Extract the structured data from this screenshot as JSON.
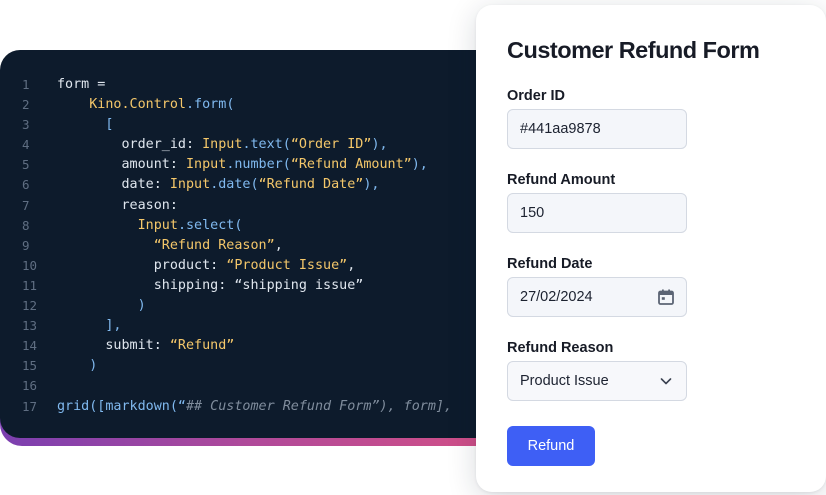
{
  "editor": {
    "lines": [
      {
        "n": "1",
        "tokens": [
          {
            "t": "form =",
            "c": "k-def"
          }
        ]
      },
      {
        "n": "2",
        "tokens": [
          {
            "t": "    ",
            "c": "k-def"
          },
          {
            "t": "Kino.Control",
            "c": "k-mod"
          },
          {
            "t": ".form",
            "c": "k-fn"
          },
          {
            "t": "(",
            "c": "k-pun"
          }
        ]
      },
      {
        "n": "3",
        "tokens": [
          {
            "t": "      [",
            "c": "k-pun"
          }
        ]
      },
      {
        "n": "4",
        "tokens": [
          {
            "t": "        order_id: ",
            "c": "k-def"
          },
          {
            "t": "Input",
            "c": "k-mod"
          },
          {
            "t": ".text",
            "c": "k-fn"
          },
          {
            "t": "(",
            "c": "k-pun"
          },
          {
            "t": "“Order ID”",
            "c": "k-str"
          },
          {
            "t": "),",
            "c": "k-pun"
          }
        ]
      },
      {
        "n": "5",
        "tokens": [
          {
            "t": "        amount: ",
            "c": "k-def"
          },
          {
            "t": "Input",
            "c": "k-mod"
          },
          {
            "t": ".number",
            "c": "k-fn"
          },
          {
            "t": "(",
            "c": "k-pun"
          },
          {
            "t": "“Refund Amount”",
            "c": "k-str"
          },
          {
            "t": "),",
            "c": "k-pun"
          }
        ]
      },
      {
        "n": "6",
        "tokens": [
          {
            "t": "        date: ",
            "c": "k-def"
          },
          {
            "t": "Input",
            "c": "k-mod"
          },
          {
            "t": ".date",
            "c": "k-fn"
          },
          {
            "t": "(",
            "c": "k-pun"
          },
          {
            "t": "“Refund Date”",
            "c": "k-str"
          },
          {
            "t": "),",
            "c": "k-pun"
          }
        ]
      },
      {
        "n": "7",
        "tokens": [
          {
            "t": "        reason:",
            "c": "k-def"
          }
        ]
      },
      {
        "n": "8",
        "tokens": [
          {
            "t": "          ",
            "c": "k-def"
          },
          {
            "t": "Input",
            "c": "k-mod"
          },
          {
            "t": ".select",
            "c": "k-fn"
          },
          {
            "t": "(",
            "c": "k-pun"
          }
        ]
      },
      {
        "n": "9",
        "tokens": [
          {
            "t": "            ",
            "c": "k-def"
          },
          {
            "t": "“Refund Reason”",
            "c": "k-str"
          },
          {
            "t": ",",
            "c": "k-def"
          }
        ]
      },
      {
        "n": "10",
        "tokens": [
          {
            "t": "            product: ",
            "c": "k-def"
          },
          {
            "t": "“Product Issue”",
            "c": "k-str"
          },
          {
            "t": ",",
            "c": "k-def"
          }
        ]
      },
      {
        "n": "11",
        "tokens": [
          {
            "t": "            shipping: “shipping issue”",
            "c": "k-def"
          }
        ]
      },
      {
        "n": "12",
        "tokens": [
          {
            "t": "          )",
            "c": "k-pun"
          }
        ]
      },
      {
        "n": "13",
        "tokens": [
          {
            "t": "      ],",
            "c": "k-pun"
          }
        ]
      },
      {
        "n": "14",
        "tokens": [
          {
            "t": "      submit: ",
            "c": "k-def"
          },
          {
            "t": "“Refund”",
            "c": "k-str"
          }
        ]
      },
      {
        "n": "15",
        "tokens": [
          {
            "t": "    )",
            "c": "k-pun"
          }
        ]
      },
      {
        "n": "16",
        "tokens": []
      },
      {
        "n": "17",
        "tokens": [
          {
            "t": "grid",
            "c": "k-fn"
          },
          {
            "t": "([",
            "c": "k-pun"
          },
          {
            "t": "markdown",
            "c": "k-fn"
          },
          {
            "t": "(“",
            "c": "k-pun"
          },
          {
            "t": "## Customer Refund Form",
            "c": "k-cmt"
          },
          {
            "t": "”), form],",
            "c": "k-cmt"
          }
        ]
      }
    ]
  },
  "form": {
    "title": "Customer Refund Form",
    "order_id": {
      "label": "Order ID",
      "value": "#441aa9878"
    },
    "amount": {
      "label": "Refund Amount",
      "value": "150"
    },
    "date": {
      "label": "Refund Date",
      "value": "27/02/2024"
    },
    "reason": {
      "label": "Refund Reason",
      "value": "Product Issue"
    },
    "submit_label": "Refund"
  },
  "colors": {
    "editor_bg": "#0d1b2c",
    "accent": "#3e5ff5",
    "title": "#171b26"
  },
  "icons": {
    "date": "calendar-icon",
    "reason": "chevron-down-icon"
  }
}
